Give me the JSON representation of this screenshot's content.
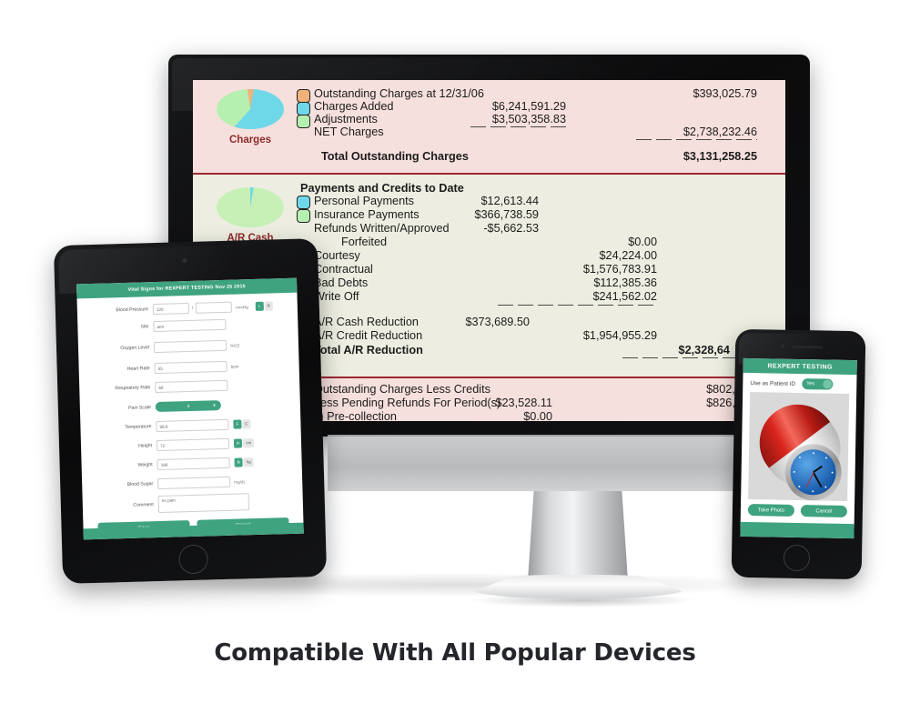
{
  "caption": "Compatible With All Popular Devices",
  "monitor": {
    "report": {
      "charges": {
        "pie_label": "Charges",
        "rows": [
          {
            "label": "Outstanding Charges at 12/31/06",
            "col1": "",
            "col2": "$393,025.79",
            "swatch": "#f0b27a"
          },
          {
            "label": "Charges Added",
            "col1": "$6,241,591.29",
            "col2": "",
            "swatch": "#6fd8e8"
          },
          {
            "label": "Adjustments",
            "col1": "$3,503,358.83",
            "col2": "",
            "swatch": "#b6f0b0"
          },
          {
            "label": "NET Charges",
            "col1": "",
            "col2": "$2,738,232.46",
            "swatch": ""
          }
        ],
        "total_label": "Total Outstanding Charges",
        "total_value": "$3,131,258.25"
      },
      "payments": {
        "pie_label": "A/R Cash",
        "heading": "Payments and Credits to Date",
        "rows": [
          {
            "label": "Personal Payments",
            "col1": "$12,613.44",
            "col2": "",
            "swatch": "#6fd8e8"
          },
          {
            "label": "Insurance Payments",
            "col1": "$366,738.59",
            "col2": "",
            "swatch": "#b6f0b0"
          },
          {
            "label": "Refunds Written/Approved",
            "col1": "-$5,662.53",
            "col2": "",
            "swatch": ""
          },
          {
            "label": "Forfeited",
            "col1": "",
            "col2": "$0.00",
            "swatch": ""
          },
          {
            "label": "Courtesy",
            "col1": "",
            "col2": "$24,224.00",
            "swatch": ""
          },
          {
            "label": "Contractual",
            "col1": "",
            "col2": "$1,576,783.91",
            "swatch": ""
          },
          {
            "label": "Bad Debts",
            "col1": "",
            "col2": "$112,385.36",
            "swatch": ""
          },
          {
            "label": "Write Off",
            "col1": "",
            "col2": "$241,562.02",
            "swatch": ""
          }
        ],
        "reductions": [
          {
            "label": "A/R Cash Reduction",
            "col1": "$373,689.50",
            "col2": ""
          },
          {
            "label": "A/R Credit Reduction",
            "col1": "",
            "col2": "$1,954,955.29"
          }
        ],
        "total_label": "Total A/R Reduction",
        "total_value": "$2,328,64"
      },
      "footer_rows": [
        {
          "label": "Outstanding Charges Less Credits",
          "col1": "",
          "col2": "$802,61"
        },
        {
          "label": "Less Pending Refunds For Period(s)",
          "col1": "$23,528.11",
          "col2": "$826,14"
        },
        {
          "label": "In Pre-collection",
          "col1": "$0.00",
          "col2": ""
        }
      ]
    }
  },
  "tablet": {
    "header": "Vital Signs for REXPERT TESTING Nov 25 2015",
    "fields": [
      {
        "label": "Blood Pressure",
        "value": "120",
        "value2": "",
        "sep": "/",
        "unit": "mmHg",
        "toggle_on": "L",
        "toggle_off": "R"
      },
      {
        "label": "Site",
        "value": "arm",
        "unit": ""
      },
      {
        "label": "Oxygen Level",
        "value": "",
        "unit": "%O2"
      },
      {
        "label": "Heart Rate",
        "value": "55",
        "unit": "bpm"
      },
      {
        "label": "Respiratory Rate",
        "value": "60",
        "unit": ""
      },
      {
        "label": "Pain Scale",
        "value": "4",
        "type": "select"
      },
      {
        "label": "Temperature",
        "value": "98.6",
        "unit": "",
        "toggle_on": "F",
        "toggle_off": "C"
      },
      {
        "label": "Height",
        "value": "72",
        "unit": "",
        "toggle_on": "in",
        "toggle_off": "cm"
      },
      {
        "label": "Weight",
        "value": "180",
        "unit": "",
        "toggle_on": "lb",
        "toggle_off": "kg"
      },
      {
        "label": "Blood Sugar",
        "value": "",
        "unit": "mg/dL"
      },
      {
        "label": "Comment",
        "value": "no pain",
        "unit": ""
      }
    ],
    "save_label": "Save",
    "cancel_label": "Cancel"
  },
  "phone": {
    "header": "REXPERT TESTING",
    "patient_id_label": "Use as Patient ID",
    "patient_id_value": "Yes",
    "take_photo_label": "Take Photo",
    "cancel_label": "Cancel"
  },
  "colors": {
    "brand_green": "#3fa37f",
    "charges_bg": "#f6e0dd",
    "payments_bg": "#edeee1",
    "rule_red": "#9d2733",
    "pie_orange": "#f0b27a",
    "pie_cyan": "#6fd8e8",
    "pie_green": "#b6f0b0"
  }
}
